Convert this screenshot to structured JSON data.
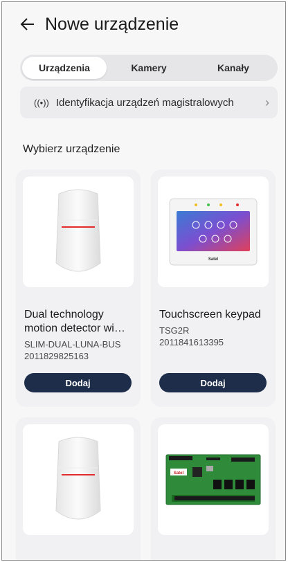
{
  "header": {
    "back_icon": "arrow-left-icon",
    "title": "Nowe urządzenie"
  },
  "tabs": [
    {
      "label": "Urządzenia",
      "active": true
    },
    {
      "label": "Kamery",
      "active": false
    },
    {
      "label": "Kanały",
      "active": false
    }
  ],
  "bus_identification": {
    "icon": "broadcast-icon",
    "icon_glyph": "((•))",
    "label": "Identyfikacja urządzeń magistralowych",
    "chevron": "›"
  },
  "section_title": "Wybierz urządzenie",
  "devices": [
    {
      "name": "Dual technology motion detector wi…",
      "model": "SLIM-DUAL-LUNA-BUS",
      "serial": "2011829825163",
      "add_label": "Dodaj",
      "image": "motion-detector"
    },
    {
      "name": "Touchscreen keypad",
      "model": "TSG2R",
      "serial": "2011841613395",
      "add_label": "Dodaj",
      "image": "touchscreen-keypad",
      "brand": "Satel"
    },
    {
      "name": "",
      "model": "",
      "serial": "",
      "image": "motion-detector"
    },
    {
      "name": "",
      "model": "",
      "serial": "",
      "image": "circuit-board",
      "brand": "Satel"
    }
  ],
  "colors": {
    "button": "#1e2d4a",
    "accent_red": "#e32b2b",
    "card_bg": "#f1f1f3"
  }
}
